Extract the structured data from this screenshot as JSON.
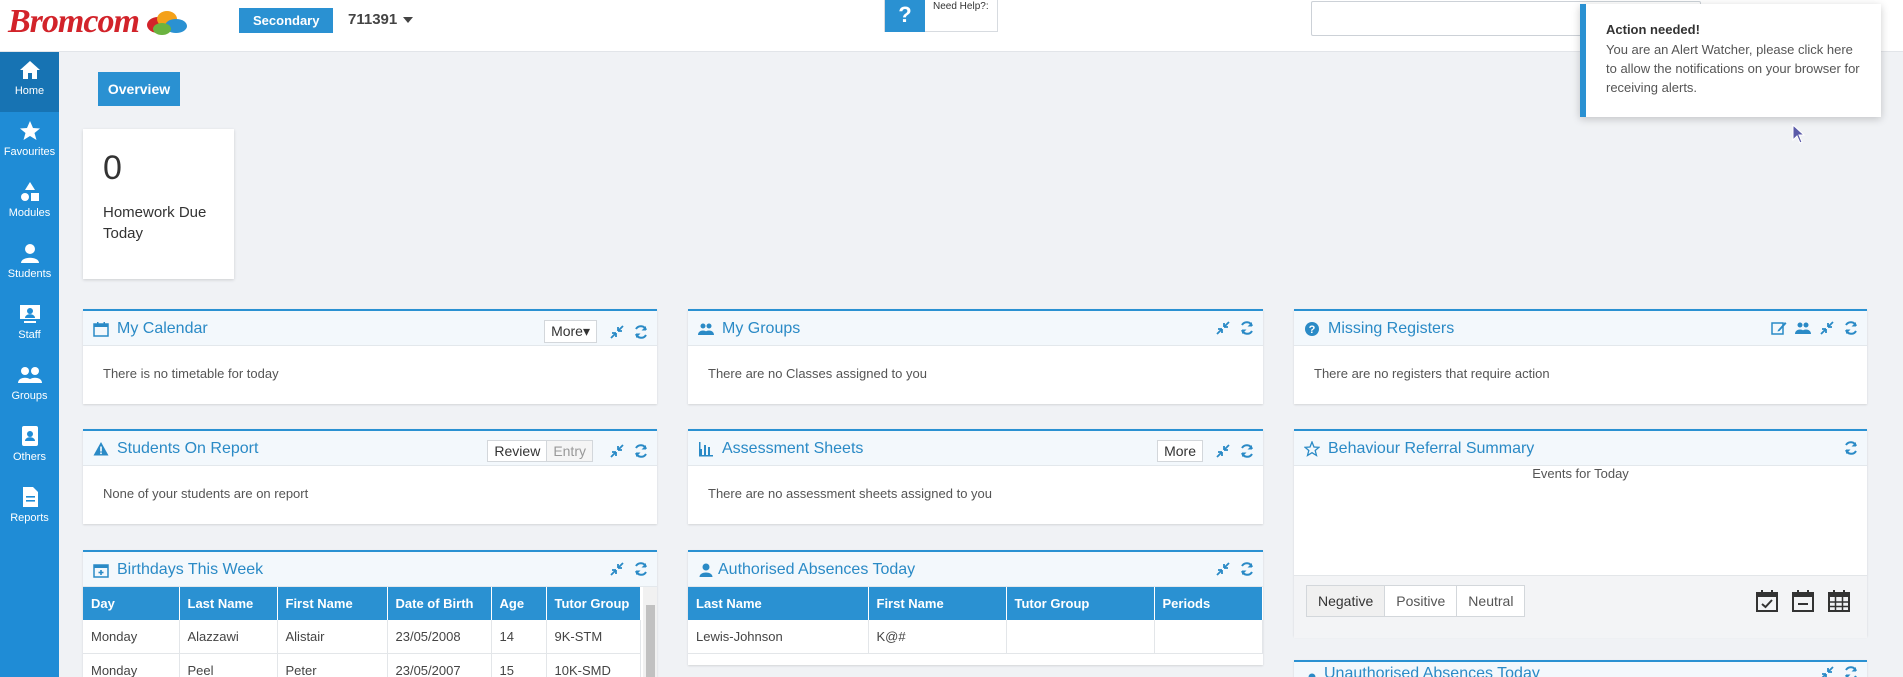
{
  "app": {
    "logo_text": "Bromcom",
    "school_type": "Secondary",
    "school_id": "711391",
    "help_label": "Need Help?:",
    "help_icon": "question-mark-icon"
  },
  "sidebar": {
    "items": [
      {
        "label": "Home",
        "icon": "home-icon"
      },
      {
        "label": "Favourites",
        "icon": "star-icon"
      },
      {
        "label": "Modules",
        "icon": "shapes-icon"
      },
      {
        "label": "Students",
        "icon": "user-icon"
      },
      {
        "label": "Staff",
        "icon": "staff-icon"
      },
      {
        "label": "Groups",
        "icon": "groups-icon"
      },
      {
        "label": "Others",
        "icon": "contact-book-icon"
      },
      {
        "label": "Reports",
        "icon": "document-icon"
      }
    ]
  },
  "main": {
    "overview_label": "Overview",
    "homework": {
      "count": "0",
      "label": "Homework Due Today"
    }
  },
  "panels": {
    "calendar": {
      "title": "My Calendar",
      "more": "More",
      "message": "There is no timetable for today"
    },
    "groups": {
      "title": "My Groups",
      "message": "There are no Classes assigned to you"
    },
    "missing": {
      "title": "Missing Registers",
      "message": "There are no registers that require action"
    },
    "report": {
      "title": "Students On Report",
      "review": "Review",
      "entry": "Entry",
      "message": "None of your students are on report"
    },
    "assessment": {
      "title": "Assessment Sheets",
      "more": "More",
      "message": "There are no assessment sheets assigned to you"
    },
    "behaviour": {
      "title": "Behaviour Referral Summary",
      "subtitle": "Events for Today",
      "tabs": [
        "Negative",
        "Positive",
        "Neutral"
      ]
    },
    "birthdays": {
      "title": "Birthdays This Week",
      "columns": [
        "Day",
        "Last Name",
        "First Name",
        "Date of Birth",
        "Age",
        "Tutor Group"
      ],
      "rows": [
        [
          "Monday",
          "Alazzawi",
          "Alistair",
          "23/05/2008",
          "14",
          "9K-STM"
        ],
        [
          "Monday",
          "Peel",
          "Peter",
          "23/05/2007",
          "15",
          "10K-SMD"
        ]
      ]
    },
    "authorised": {
      "title": "Authorised Absences Today",
      "columns": [
        "Last Name",
        "First Name",
        "Tutor Group",
        "Periods"
      ],
      "rows": [
        [
          "Lewis-Johnson",
          "K@#",
          "",
          ""
        ]
      ]
    },
    "unauthorised": {
      "title": "Unauthorised Absences Today"
    }
  },
  "toast": {
    "title": "Action needed!",
    "message": "You are an Alert Watcher, please click here to allow the notifications on your browser for receiving alerts."
  },
  "colors": {
    "accent": "#2a91d2",
    "sidebar": "#1f8cd6",
    "brand_red": "#d2232a"
  }
}
